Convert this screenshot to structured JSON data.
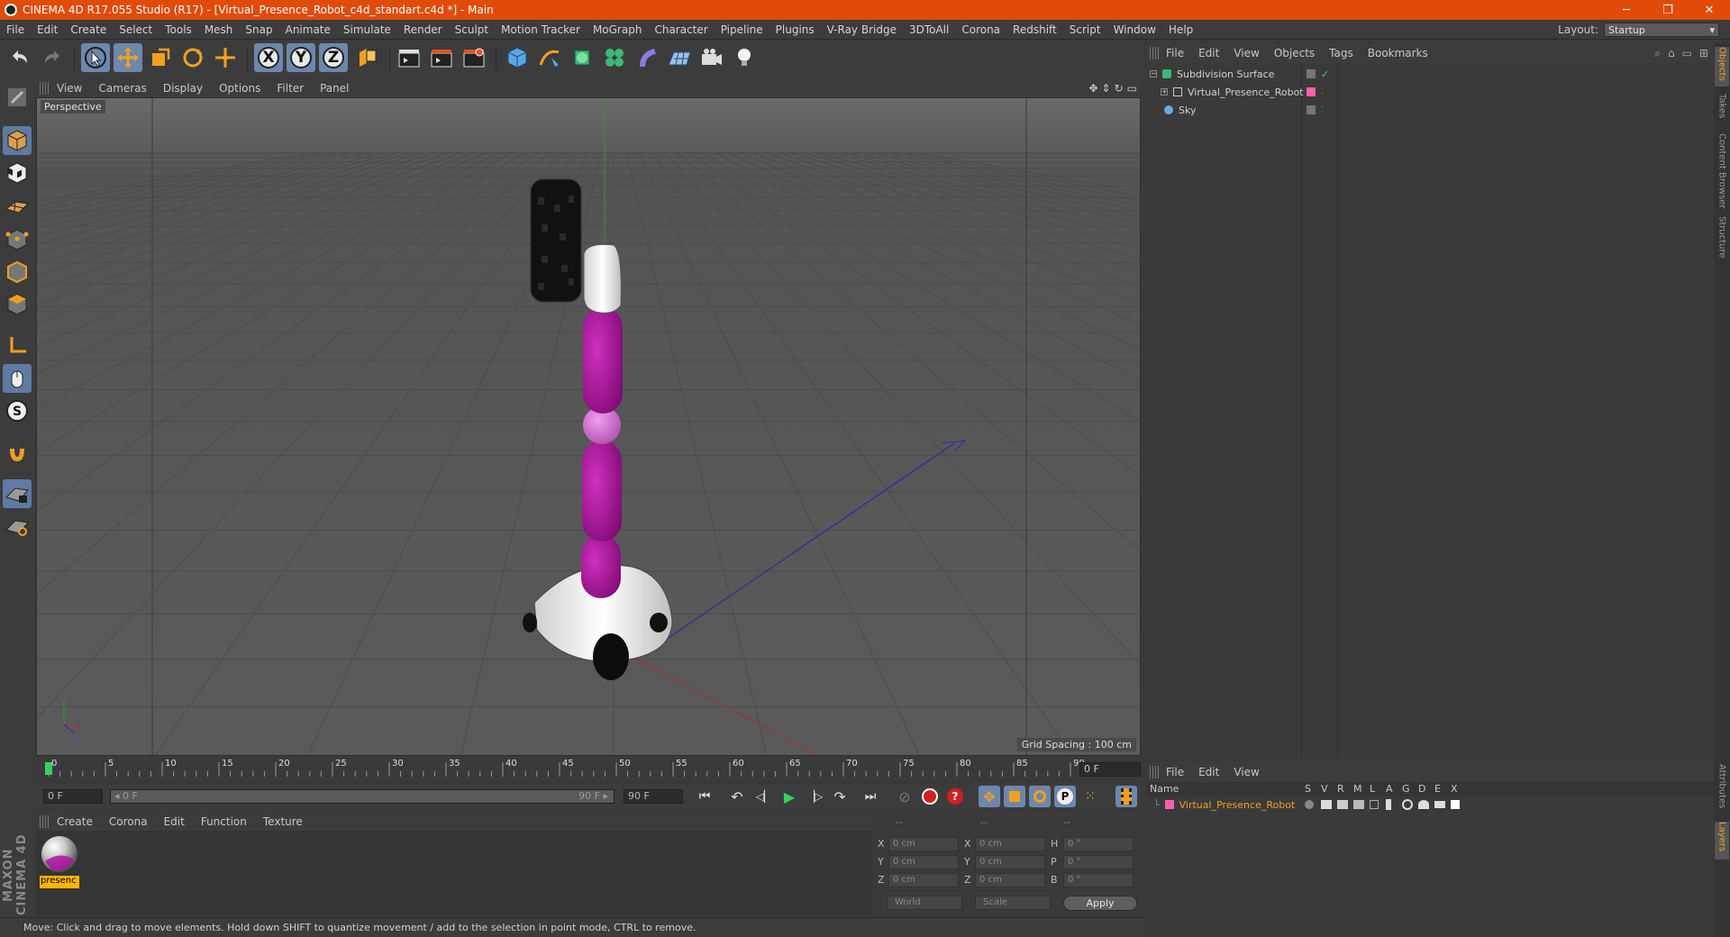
{
  "window": {
    "title": "CINEMA 4D R17.055 Studio (R17) - [Virtual_Presence_Robot_c4d_standart.c4d *] - Main",
    "minimize": "─",
    "maximize": "❐",
    "close": "✕"
  },
  "menu": [
    "File",
    "Edit",
    "Create",
    "Select",
    "Tools",
    "Mesh",
    "Snap",
    "Animate",
    "Simulate",
    "Render",
    "Sculpt",
    "Motion Tracker",
    "MoGraph",
    "Character",
    "Pipeline",
    "Plugins",
    "V-Ray Bridge",
    "3DToAll",
    "Corona",
    "Redshift",
    "Script",
    "Window",
    "Help"
  ],
  "layout": {
    "label": "Layout:",
    "value": "Startup"
  },
  "toolbar": {
    "axis_x": "X",
    "axis_y": "Y",
    "axis_z": "Z"
  },
  "viewport": {
    "menu": [
      "View",
      "Cameras",
      "Display",
      "Options",
      "Filter",
      "Panel"
    ],
    "label": "Perspective",
    "grid_spacing": "Grid Spacing : 100 cm"
  },
  "timeline": {
    "ticks": [
      "0",
      "5",
      "10",
      "15",
      "20",
      "25",
      "30",
      "35",
      "40",
      "45",
      "50",
      "55",
      "60",
      "65",
      "70",
      "75",
      "80",
      "85",
      "90"
    ],
    "current_frame": "0 F",
    "start_field": "0 F",
    "range_start": "◂ 0 F",
    "range_end": "90 F ▸",
    "end_field": "90 F"
  },
  "material_manager": {
    "menu": [
      "Create",
      "Corona",
      "Edit",
      "Function",
      "Texture"
    ],
    "material_name": "presenc"
  },
  "coordinates": {
    "headers": [
      "--",
      "--",
      "--"
    ],
    "rows": [
      {
        "a": "X",
        "av": "0 cm",
        "b": "X",
        "bv": "0 cm",
        "c": "H",
        "cv": "0 °"
      },
      {
        "a": "Y",
        "av": "0 cm",
        "b": "Y",
        "bv": "0 cm",
        "c": "P",
        "cv": "0 °"
      },
      {
        "a": "Z",
        "av": "0 cm",
        "b": "Z",
        "bv": "0 cm",
        "c": "B",
        "cv": "0 °"
      }
    ],
    "world": "World",
    "scale": "Scale",
    "apply": "Apply"
  },
  "status": "Move: Click and drag to move elements. Hold down SHIFT to quantize movement / add to the selection in point mode, CTRL to remove.",
  "objects": {
    "menu": [
      "File",
      "Edit",
      "View",
      "Objects",
      "Tags",
      "Bookmarks"
    ],
    "items": [
      {
        "name": "Subdivision Surface"
      },
      {
        "name": "Virtual_Presence_Robot"
      },
      {
        "name": "Sky"
      }
    ]
  },
  "layers": {
    "menu": [
      "File",
      "Edit",
      "View"
    ],
    "columns": [
      "Name",
      "S",
      "V",
      "R",
      "M",
      "L",
      "A",
      "G",
      "D",
      "E",
      "X"
    ],
    "item": "Virtual_Presence_Robot"
  },
  "side_tabs": [
    "Objects",
    "Takes",
    "Content Browser",
    "Structure",
    "Attributes",
    "Layers"
  ],
  "brand": "MAXON CINEMA 4D",
  "colors": {
    "accent_orange": "#e04b0a",
    "layer_pink": "#ff5fa8",
    "robot_magenta": "#b0109e",
    "selected_blue": "#6d87ad"
  }
}
